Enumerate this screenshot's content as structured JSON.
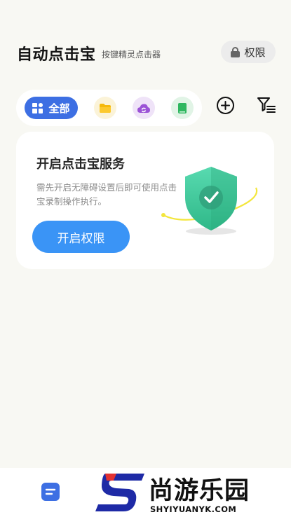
{
  "header": {
    "title": "自动点击宝",
    "subtitle": "按键精灵点击器",
    "permission_label": "权限"
  },
  "filter_bar": {
    "all_label": "全部",
    "categories": [
      {
        "icon": "folder-icon",
        "color": "#f5b90b"
      },
      {
        "icon": "cloud-sync-icon",
        "color": "#9b52d6"
      },
      {
        "icon": "book-icon",
        "color": "#2fb760"
      }
    ]
  },
  "toolbar": {
    "add_icon": "plus-circle-icon",
    "filter_icon": "filter-list-icon"
  },
  "service_card": {
    "title": "开启点击宝服务",
    "description": "需先开启无障碍设置后即可使用点击宝录制操作执行。",
    "button_label": "开启权限"
  },
  "colors": {
    "accent": "#3d6fe3",
    "button": "#3a94f6",
    "shield": "#3fc99a",
    "background": "#f8f8f3"
  },
  "watermark": {
    "text_cn": "尚游乐园",
    "text_en": "SHYIYUANYK.COM"
  }
}
